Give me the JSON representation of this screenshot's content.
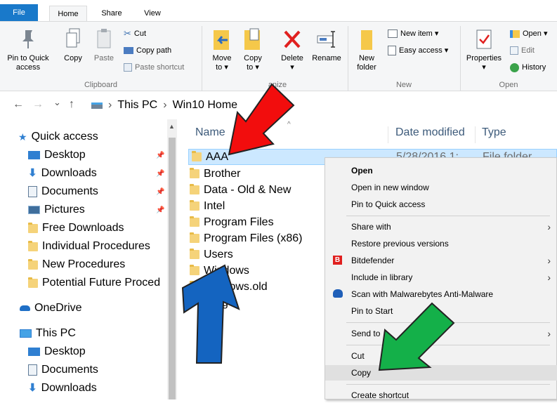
{
  "ribbon_tabs": {
    "file": "File",
    "home": "Home",
    "share": "Share",
    "view": "View"
  },
  "clipboard": {
    "pin": [
      "Pin to Quick",
      "access"
    ],
    "copy": "Copy",
    "paste": "Paste",
    "cut": "Cut",
    "copy_path": "Copy path",
    "paste_shortcut": "Paste shortcut",
    "label": "Clipboard"
  },
  "organize": {
    "move_to": [
      "Move",
      "to ▾"
    ],
    "copy_to": [
      "Copy",
      "to ▾"
    ],
    "delete": [
      "Delete",
      "▾"
    ],
    "rename": "Rename",
    "label": "anize"
  },
  "new_group": {
    "new_folder": [
      "New",
      "folder"
    ],
    "new_item": "New item ▾",
    "easy_access": "Easy access ▾",
    "label": "New"
  },
  "open_group": {
    "properties": [
      "Properties",
      "▾"
    ],
    "open": "Open ▾",
    "edit": "Edit",
    "history": "History",
    "label": "Open"
  },
  "address": {
    "back": "←",
    "forward": "→",
    "recent": "⌄",
    "up": "↑",
    "crumbs": [
      "This PC",
      "Win10 Home"
    ],
    "sep": "›"
  },
  "nav": {
    "quick_access": "Quick access",
    "items": [
      "Desktop",
      "Downloads",
      "Documents",
      "Pictures",
      "Free Downloads",
      "Individual Procedures",
      "New Procedures",
      "Potential Future Proced"
    ],
    "onedrive": "OneDrive",
    "this_pc": "This PC",
    "pc_items": [
      "Desktop",
      "Documents",
      "Downloads"
    ]
  },
  "columns": {
    "name": "Name",
    "date": "Date modified",
    "type": "Type"
  },
  "files": [
    {
      "name": "AAA",
      "date": "5/28/2016 1:",
      "type": "File folder"
    },
    {
      "name": "Brother"
    },
    {
      "name": "Data - Old & New"
    },
    {
      "name": "Intel"
    },
    {
      "name": "Program Files"
    },
    {
      "name": "Program Files (x86)"
    },
    {
      "name": "Users"
    },
    {
      "name": "Windows"
    },
    {
      "name": "Windows.old"
    },
    {
      "name": "g"
    }
  ],
  "context_menu": [
    "Open",
    "Open in new window",
    "Pin to Quick access",
    "Share with",
    "Restore previous versions",
    "Bitdefender",
    "Include in library",
    "Scan with Malwarebytes Anti-Malware",
    "Pin to Start",
    "Send to",
    "Cut",
    "Copy",
    "Create shortcut"
  ],
  "colors": {
    "red_arrow": "#f20d0d",
    "blue_arrow": "#1464c0",
    "green_arrow": "#14b049",
    "selection": "#cce8ff",
    "file_tab": "#1979ca"
  }
}
